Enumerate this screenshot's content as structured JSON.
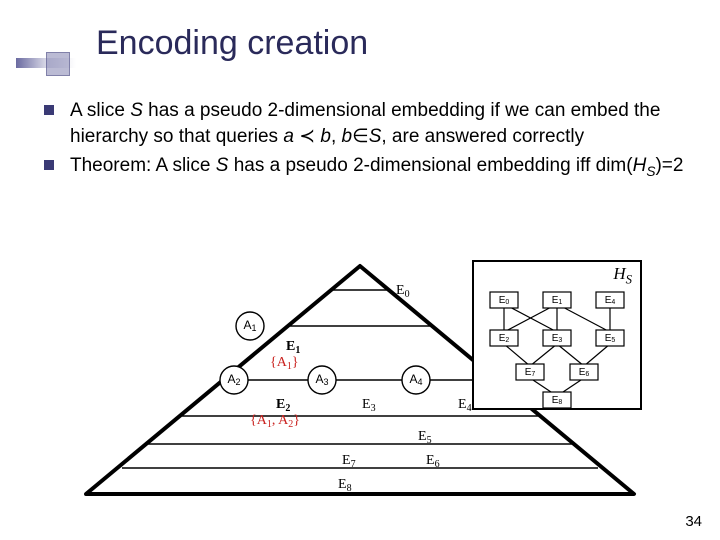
{
  "title": "Encoding creation",
  "bullets": {
    "b1": {
      "p1": "A slice ",
      "S": "S",
      "p2": "  has a pseudo 2-dimensional embedding if we can embed the hierarchy so that queries ",
      "a": "a",
      "prec": " ≺ ",
      "b": "b",
      "comma": ", ",
      "b2": "b",
      "in": "∈",
      "S2": "S",
      "end": ", are answered correctly"
    },
    "b2": {
      "p1": "Theorem: A slice ",
      "S": "S",
      "p2": "  has a pseudo 2-dimensional embedding iff dim(",
      "HS_H": "H",
      "HS_S": "S",
      "end": ")=2"
    }
  },
  "hs": {
    "label_H": "H",
    "label_S": "S",
    "E0": "E",
    "E0s": "0",
    "E1": "E",
    "E1s": "1",
    "E4": "E",
    "E4s": "4",
    "E2": "E",
    "E2s": "2",
    "E3": "E",
    "E3s": "3",
    "E5": "E",
    "E5s": "5",
    "E7": "E",
    "E7s": "7",
    "E6": "E",
    "E6s": "6",
    "E8": "E",
    "E8s": "8"
  },
  "tri": {
    "A1": "A",
    "A1s": "1",
    "A2": "A",
    "A2s": "2",
    "A3": "A",
    "A3s": "3",
    "A4": "A",
    "A4s": "4",
    "E0": "E",
    "E0s": "0",
    "E1": "E",
    "E1s": "1",
    "R1": "{A",
    "R1a": "1",
    "R1b": "}",
    "E2": "E",
    "E2s": "2",
    "R2": "{A",
    "R2a": "1",
    "R2m": ", A",
    "R2b": "2",
    "R2e": "}",
    "E3": "E",
    "E3s": "3",
    "E4": "E",
    "E4s": "4",
    "E5": "E",
    "E5s": "5",
    "E7": "E",
    "E7s": "7",
    "E6": "E",
    "E6s": "6",
    "E8": "E",
    "E8s": "8"
  },
  "page": "34"
}
